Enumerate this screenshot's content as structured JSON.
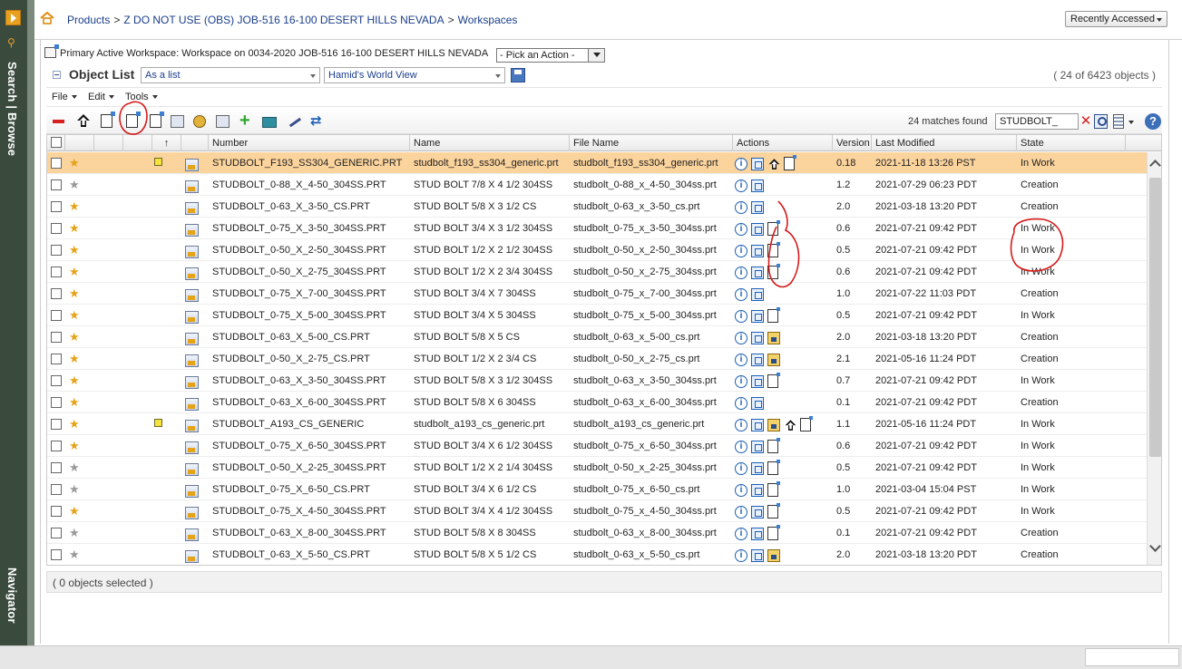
{
  "rail": {
    "search_label": "Search | Browse",
    "nav_label": "Navigator"
  },
  "header": {
    "breadcrumb": [
      "Products",
      "Z DO NOT USE (OBS) JOB-516 16-100 DESERT HILLS NEVADA",
      "Workspaces"
    ],
    "separator": ">",
    "recent_label": "Recently Accessed"
  },
  "workspace": {
    "label": "Primary Active Workspace: Workspace on 0034-2020 JOB-516 16-100 DESERT HILLS NEVADA",
    "action_placeholder": "- Pick an Action -"
  },
  "object_list": {
    "title": "Object List",
    "display_mode": "As a list",
    "view_name": "Hamid's World View",
    "count_text": "( 24 of 6423 objects )"
  },
  "menus": [
    "File",
    "Edit",
    "Tools"
  ],
  "toolbar": {
    "matches_text": "24 matches found",
    "search_value": "STUDBOLT_",
    "help": "?"
  },
  "columns": {
    "sort_marker": "↑",
    "number": "Number",
    "name": "Name",
    "file_name": "File Name",
    "actions": "Actions",
    "version": "Version",
    "modified": "Last Modified",
    "state": "State"
  },
  "rows": [
    {
      "fav": true,
      "note": true,
      "selected": true,
      "number": "STUDBOLT_F193_SS304_GENERIC.PRT",
      "name": "studbolt_f193_ss304_generic.prt",
      "file": "studbolt_f193_ss304_generic.prt",
      "actions": [
        "info",
        "view",
        "checkin",
        "doc"
      ],
      "version": "0.18",
      "modified": "2021-11-18 13:26 PST",
      "state": "In Work"
    },
    {
      "fav": false,
      "note": false,
      "selected": false,
      "number": "STUDBOLT_0-88_X_4-50_304SS.PRT",
      "name": "STUD BOLT 7/8 X 4 1/2 304SS",
      "file": "studbolt_0-88_x_4-50_304ss.prt",
      "actions": [
        "info",
        "view"
      ],
      "version": "1.2",
      "modified": "2021-07-29 06:23 PDT",
      "state": "Creation"
    },
    {
      "fav": true,
      "note": false,
      "selected": false,
      "number": "STUDBOLT_0-63_X_3-50_CS.PRT",
      "name": "STUD BOLT 5/8 X 3 1/2 CS",
      "file": "studbolt_0-63_x_3-50_cs.prt",
      "actions": [
        "info",
        "view"
      ],
      "version": "2.0",
      "modified": "2021-03-18 13:20 PDT",
      "state": "Creation"
    },
    {
      "fav": true,
      "note": false,
      "selected": false,
      "number": "STUDBOLT_0-75_X_3-50_304SS.PRT",
      "name": "STUD BOLT 3/4 X 3 1/2 304SS",
      "file": "studbolt_0-75_x_3-50_304ss.prt",
      "actions": [
        "info",
        "view",
        "doc"
      ],
      "version": "0.6",
      "modified": "2021-07-21 09:42 PDT",
      "state": "In Work"
    },
    {
      "fav": true,
      "note": false,
      "selected": false,
      "number": "STUDBOLT_0-50_X_2-50_304SS.PRT",
      "name": "STUD BOLT 1/2 X 2 1/2 304SS",
      "file": "studbolt_0-50_x_2-50_304ss.prt",
      "actions": [
        "info",
        "view",
        "doc"
      ],
      "version": "0.5",
      "modified": "2021-07-21 09:42 PDT",
      "state": "In Work"
    },
    {
      "fav": true,
      "note": false,
      "selected": false,
      "number": "STUDBOLT_0-50_X_2-75_304SS.PRT",
      "name": "STUD BOLT 1/2 X 2 3/4 304SS",
      "file": "studbolt_0-50_x_2-75_304ss.prt",
      "actions": [
        "info",
        "view",
        "doc"
      ],
      "version": "0.6",
      "modified": "2021-07-21 09:42 PDT",
      "state": "In Work"
    },
    {
      "fav": true,
      "note": false,
      "selected": false,
      "number": "STUDBOLT_0-75_X_7-00_304SS.PRT",
      "name": "STUD BOLT 3/4 X 7 304SS",
      "file": "studbolt_0-75_x_7-00_304ss.prt",
      "actions": [
        "info",
        "view"
      ],
      "version": "1.0",
      "modified": "2021-07-22 11:03 PDT",
      "state": "Creation"
    },
    {
      "fav": true,
      "note": false,
      "selected": false,
      "number": "STUDBOLT_0-75_X_5-00_304SS.PRT",
      "name": "STUD BOLT 3/4 X 5 304SS",
      "file": "studbolt_0-75_x_5-00_304ss.prt",
      "actions": [
        "info",
        "view",
        "doc"
      ],
      "version": "0.5",
      "modified": "2021-07-21 09:42 PDT",
      "state": "In Work"
    },
    {
      "fav": true,
      "note": false,
      "selected": false,
      "number": "STUDBOLT_0-63_X_5-00_CS.PRT",
      "name": "STUD BOLT 5/8 X 5 CS",
      "file": "studbolt_0-63_x_5-00_cs.prt",
      "actions": [
        "info",
        "view",
        "cad"
      ],
      "version": "2.0",
      "modified": "2021-03-18 13:20 PDT",
      "state": "Creation"
    },
    {
      "fav": true,
      "note": false,
      "selected": false,
      "number": "STUDBOLT_0-50_X_2-75_CS.PRT",
      "name": "STUD BOLT 1/2 X 2 3/4 CS",
      "file": "studbolt_0-50_x_2-75_cs.prt",
      "actions": [
        "info",
        "view",
        "cad"
      ],
      "version": "2.1",
      "modified": "2021-05-16 11:24 PDT",
      "state": "Creation"
    },
    {
      "fav": true,
      "note": false,
      "selected": false,
      "number": "STUDBOLT_0-63_X_3-50_304SS.PRT",
      "name": "STUD BOLT 5/8 X 3 1/2 304SS",
      "file": "studbolt_0-63_x_3-50_304ss.prt",
      "actions": [
        "info",
        "view",
        "doc"
      ],
      "version": "0.7",
      "modified": "2021-07-21 09:42 PDT",
      "state": "In Work"
    },
    {
      "fav": true,
      "note": false,
      "selected": false,
      "number": "STUDBOLT_0-63_X_6-00_304SS.PRT",
      "name": "STUD BOLT 5/8 X 6 304SS",
      "file": "studbolt_0-63_x_6-00_304ss.prt",
      "actions": [
        "info",
        "view"
      ],
      "version": "0.1",
      "modified": "2021-07-21 09:42 PDT",
      "state": "Creation"
    },
    {
      "fav": true,
      "note": true,
      "selected": false,
      "number": "STUDBOLT_A193_CS_GENERIC",
      "name": "studbolt_a193_cs_generic.prt",
      "file": "studbolt_a193_cs_generic.prt",
      "actions": [
        "info",
        "view",
        "cad",
        "checkin",
        "doc"
      ],
      "version": "1.1",
      "modified": "2021-05-16 11:24 PDT",
      "state": "In Work"
    },
    {
      "fav": true,
      "note": false,
      "selected": false,
      "number": "STUDBOLT_0-75_X_6-50_304SS.PRT",
      "name": "STUD BOLT 3/4 X 6 1/2 304SS",
      "file": "studbolt_0-75_x_6-50_304ss.prt",
      "actions": [
        "info",
        "view",
        "doc"
      ],
      "version": "0.6",
      "modified": "2021-07-21 09:42 PDT",
      "state": "In Work"
    },
    {
      "fav": false,
      "note": false,
      "selected": false,
      "number": "STUDBOLT_0-50_X_2-25_304SS.PRT",
      "name": "STUD BOLT 1/2 X 2 1/4 304SS",
      "file": "studbolt_0-50_x_2-25_304ss.prt",
      "actions": [
        "info",
        "view",
        "doc"
      ],
      "version": "0.5",
      "modified": "2021-07-21 09:42 PDT",
      "state": "In Work"
    },
    {
      "fav": false,
      "note": false,
      "selected": false,
      "number": "STUDBOLT_0-75_X_6-50_CS.PRT",
      "name": "STUD BOLT 3/4 X 6 1/2 CS",
      "file": "studbolt_0-75_x_6-50_cs.prt",
      "actions": [
        "info",
        "view",
        "doc"
      ],
      "version": "1.0",
      "modified": "2021-03-04 15:04 PST",
      "state": "In Work"
    },
    {
      "fav": true,
      "note": false,
      "selected": false,
      "number": "STUDBOLT_0-75_X_4-50_304SS.PRT",
      "name": "STUD BOLT 3/4 X 4 1/2 304SS",
      "file": "studbolt_0-75_x_4-50_304ss.prt",
      "actions": [
        "info",
        "view",
        "doc"
      ],
      "version": "0.5",
      "modified": "2021-07-21 09:42 PDT",
      "state": "In Work"
    },
    {
      "fav": false,
      "note": false,
      "selected": false,
      "number": "STUDBOLT_0-63_X_8-00_304SS.PRT",
      "name": "STUD BOLT 5/8 X 8 304SS",
      "file": "studbolt_0-63_x_8-00_304ss.prt",
      "actions": [
        "info",
        "view",
        "doc"
      ],
      "version": "0.1",
      "modified": "2021-07-21 09:42 PDT",
      "state": "Creation"
    },
    {
      "fav": false,
      "note": false,
      "selected": false,
      "number": "STUDBOLT_0-63_X_5-50_CS.PRT",
      "name": "STUD BOLT 5/8 X 5 1/2 CS",
      "file": "studbolt_0-63_x_5-50_cs.prt",
      "actions": [
        "info",
        "view",
        "cad"
      ],
      "version": "2.0",
      "modified": "2021-03-18 13:20 PDT",
      "state": "Creation"
    }
  ],
  "selection_text": "( 0 objects selected )",
  "colors": {
    "selected_row": "#fbd39c",
    "favorite_star": "#e6a317",
    "link": "#1a3e8c",
    "annotation": "#d41a1a"
  }
}
